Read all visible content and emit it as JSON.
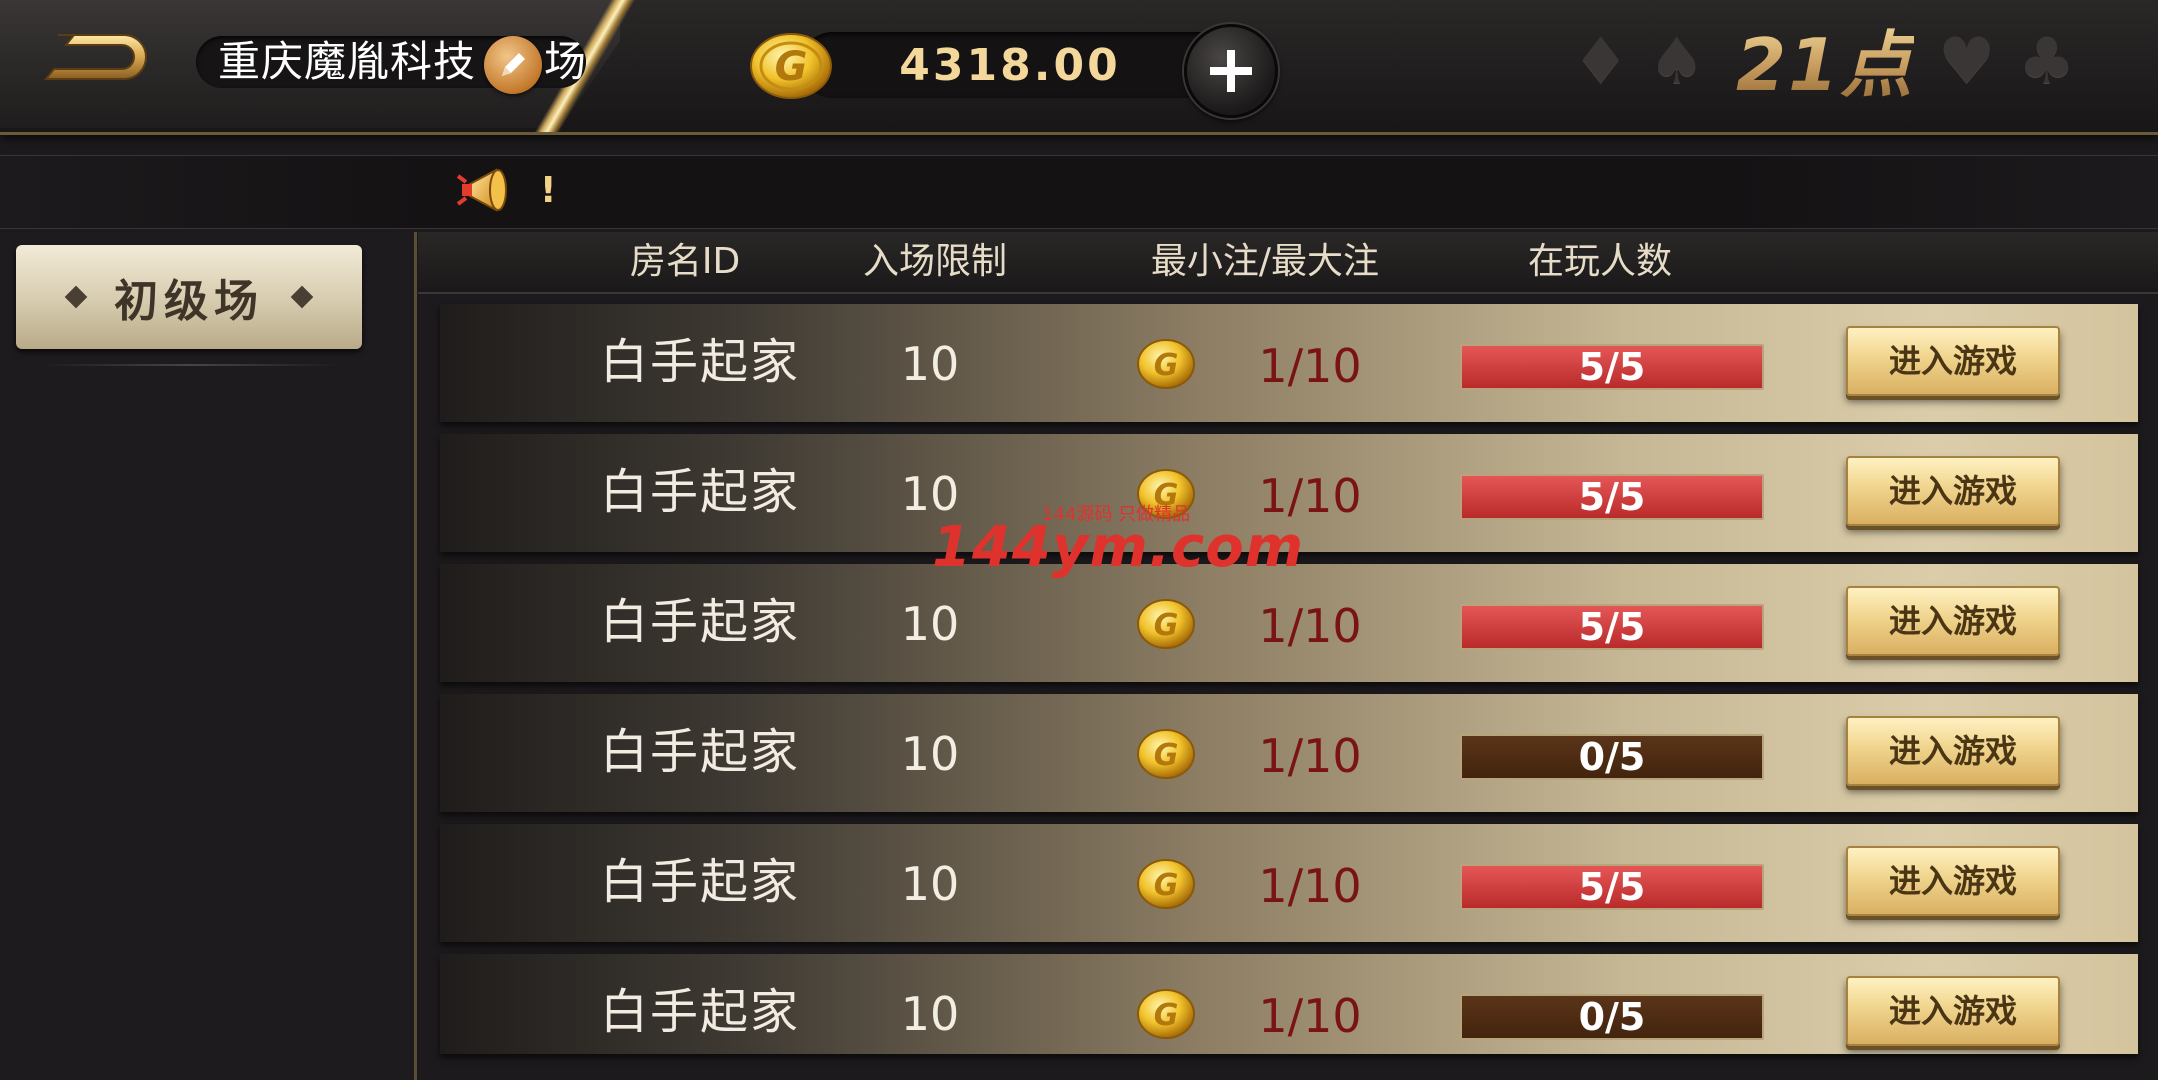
{
  "header": {
    "room_name": "重庆魔胤科技",
    "room_name_suffix": "场",
    "coins": "4318.00",
    "game_title": "21点"
  },
  "notice": {
    "text": "!"
  },
  "sidebar": {
    "tier_label": "初级场"
  },
  "table": {
    "columns": [
      "房名ID",
      "入场限制",
      "最小注/最大注",
      "在玩人数"
    ],
    "enter_label": "进入游戏",
    "rows": [
      {
        "name": "白手起家",
        "limit": "10",
        "bets": "1/10",
        "players": "5/5",
        "status": "full"
      },
      {
        "name": "白手起家",
        "limit": "10",
        "bets": "1/10",
        "players": "5/5",
        "status": "full"
      },
      {
        "name": "白手起家",
        "limit": "10",
        "bets": "1/10",
        "players": "5/5",
        "status": "full"
      },
      {
        "name": "白手起家",
        "limit": "10",
        "bets": "1/10",
        "players": "0/5",
        "status": "empty"
      },
      {
        "name": "白手起家",
        "limit": "10",
        "bets": "1/10",
        "players": "5/5",
        "status": "full"
      },
      {
        "name": "白手起家",
        "limit": "10",
        "bets": "1/10",
        "players": "0/5",
        "status": "empty"
      }
    ]
  },
  "watermark": {
    "text": "144ym.com",
    "sub": "144源码 只做精品"
  },
  "colors": {
    "full": "#d03a3a",
    "empty": "#4e2c13",
    "gold": "#f0d48d"
  },
  "icons": [
    "back-arrow-icon",
    "edit-pencil-icon",
    "gold-coin-icon",
    "plus-icon",
    "diamond-suit-icon",
    "spade-suit-icon",
    "heart-suit-icon",
    "club-suit-icon",
    "horn-speaker-icon"
  ]
}
